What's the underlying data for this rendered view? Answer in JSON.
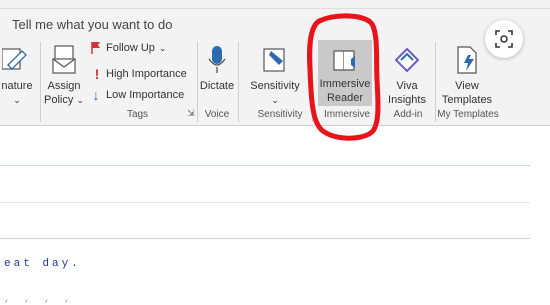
{
  "tellme": {
    "placeholder": "Tell me what you want to do"
  },
  "ribbon": {
    "signature": {
      "label": "nature"
    },
    "assign_policy": {
      "line1": "Assign",
      "line2": "Policy"
    },
    "follow_up": {
      "label": "Follow Up"
    },
    "high_importance": {
      "label": "High Importance"
    },
    "low_importance": {
      "label": "Low Importance"
    },
    "dictate": {
      "label": "Dictate"
    },
    "sensitivity": {
      "label": "Sensitivity"
    },
    "immersive_reader": {
      "line1": "Immersive",
      "line2": "Reader"
    },
    "viva": {
      "line1": "Viva",
      "line2": "Insights"
    },
    "view_templates": {
      "line1": "View",
      "line2": "Templates"
    },
    "groups": {
      "tags": "Tags",
      "voice": "Voice",
      "sensitivity": "Sensitivity",
      "immersive": "Immersive",
      "addin": "Add-in",
      "templates": "My Templates"
    }
  },
  "body": {
    "text": "eat day.",
    "faint_text": "     ,  ,  ,  ,"
  },
  "colors": {
    "highlight": "#c9c9c9",
    "annotation": "#e8141a",
    "flag": "#d13438",
    "accent_blue": "#2b6cb0"
  }
}
